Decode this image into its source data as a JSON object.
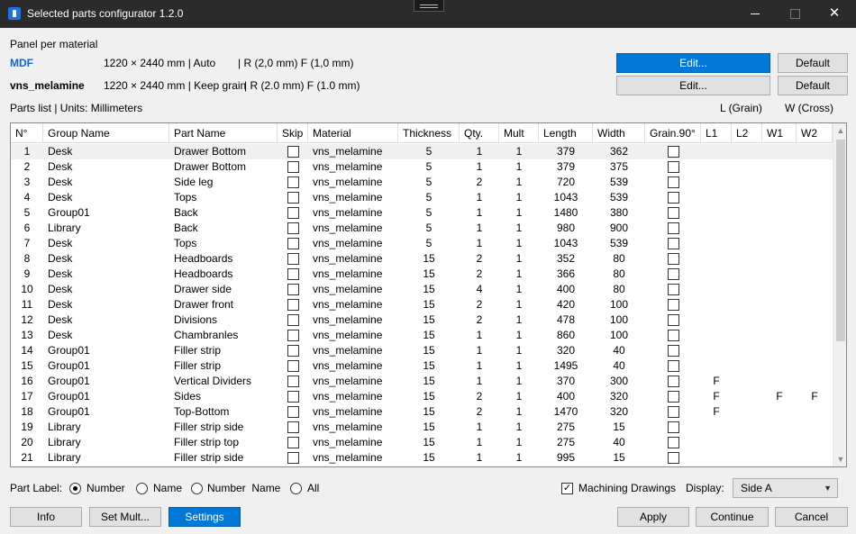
{
  "window": {
    "title": "Selected parts configurator 1.2.0",
    "close_glyph": "✕"
  },
  "panel": {
    "heading": "Panel per material",
    "materials": [
      {
        "name": "MDF",
        "size": "1220 × 2440 mm | Auto",
        "params": "| R (2,0 mm)  F (1,0 mm)",
        "edit_label": "Edit...",
        "default_label": "Default"
      },
      {
        "name": "vns_melamine",
        "size": "1220 × 2440 mm | Keep grain",
        "params": "| R (2.0 mm)  F (1.0 mm)",
        "edit_label": "Edit...",
        "default_label": "Default"
      }
    ]
  },
  "parts": {
    "caption": "Parts list | Units: Millimeters",
    "l_grain": "L (Grain)",
    "w_cross": "W (Cross)",
    "columns": [
      "N°",
      "Group Name",
      "Part Name",
      "Skip",
      "Material",
      "Thickness",
      "Qty.",
      "Mult",
      "Length",
      "Width",
      "Grain.90°",
      "L1",
      "L2",
      "W1",
      "W2"
    ],
    "rows": [
      [
        "1",
        "Desk",
        "Drawer Bottom",
        "",
        "vns_melamine",
        "5",
        "1",
        "1",
        "379",
        "362",
        "",
        "",
        "",
        "",
        ""
      ],
      [
        "2",
        "Desk",
        "Drawer Bottom",
        "",
        "vns_melamine",
        "5",
        "1",
        "1",
        "379",
        "375",
        "",
        "",
        "",
        "",
        ""
      ],
      [
        "3",
        "Desk",
        "Side leg",
        "",
        "vns_melamine",
        "5",
        "2",
        "1",
        "720",
        "539",
        "",
        "",
        "",
        "",
        ""
      ],
      [
        "4",
        "Desk",
        "Tops",
        "",
        "vns_melamine",
        "5",
        "1",
        "1",
        "1043",
        "539",
        "",
        "",
        "",
        "",
        ""
      ],
      [
        "5",
        "Group01",
        "Back",
        "",
        "vns_melamine",
        "5",
        "1",
        "1",
        "1480",
        "380",
        "",
        "",
        "",
        "",
        ""
      ],
      [
        "6",
        "Library",
        "Back",
        "",
        "vns_melamine",
        "5",
        "1",
        "1",
        "980",
        "900",
        "",
        "",
        "",
        "",
        ""
      ],
      [
        "7",
        "Desk",
        "Tops",
        "",
        "vns_melamine",
        "5",
        "1",
        "1",
        "1043",
        "539",
        "",
        "",
        "",
        "",
        ""
      ],
      [
        "8",
        "Desk",
        "Headboards",
        "",
        "vns_melamine",
        "15",
        "2",
        "1",
        "352",
        "80",
        "",
        "",
        "",
        "",
        ""
      ],
      [
        "9",
        "Desk",
        "Headboards",
        "",
        "vns_melamine",
        "15",
        "2",
        "1",
        "366",
        "80",
        "",
        "",
        "",
        "",
        ""
      ],
      [
        "10",
        "Desk",
        "Drawer side",
        "",
        "vns_melamine",
        "15",
        "4",
        "1",
        "400",
        "80",
        "",
        "",
        "",
        "",
        ""
      ],
      [
        "11",
        "Desk",
        "Drawer front",
        "",
        "vns_melamine",
        "15",
        "2",
        "1",
        "420",
        "100",
        "",
        "",
        "",
        "",
        ""
      ],
      [
        "12",
        "Desk",
        "Divisions",
        "",
        "vns_melamine",
        "15",
        "2",
        "1",
        "478",
        "100",
        "",
        "",
        "",
        "",
        ""
      ],
      [
        "13",
        "Desk",
        "Chambranles",
        "",
        "vns_melamine",
        "15",
        "1",
        "1",
        "860",
        "100",
        "",
        "",
        "",
        "",
        ""
      ],
      [
        "14",
        "Group01",
        "Filler strip",
        "",
        "vns_melamine",
        "15",
        "1",
        "1",
        "320",
        "40",
        "",
        "",
        "",
        "",
        ""
      ],
      [
        "15",
        "Group01",
        "Filler strip",
        "",
        "vns_melamine",
        "15",
        "1",
        "1",
        "1495",
        "40",
        "",
        "",
        "",
        "",
        ""
      ],
      [
        "16",
        "Group01",
        "Vertical Dividers",
        "",
        "vns_melamine",
        "15",
        "1",
        "1",
        "370",
        "300",
        "",
        "F",
        "",
        "",
        ""
      ],
      [
        "17",
        "Group01",
        "Sides",
        "",
        "vns_melamine",
        "15",
        "2",
        "1",
        "400",
        "320",
        "",
        "F",
        "",
        "F",
        "F"
      ],
      [
        "18",
        "Group01",
        "Top-Bottom",
        "",
        "vns_melamine",
        "15",
        "2",
        "1",
        "1470",
        "320",
        "",
        "F",
        "",
        "",
        ""
      ],
      [
        "19",
        "Library",
        "Filler strip side",
        "",
        "vns_melamine",
        "15",
        "1",
        "1",
        "275",
        "15",
        "",
        "",
        "",
        "",
        ""
      ],
      [
        "20",
        "Library",
        "Filler strip top",
        "",
        "vns_melamine",
        "15",
        "1",
        "1",
        "275",
        "40",
        "",
        "",
        "",
        "",
        ""
      ],
      [
        "21",
        "Library",
        "Filler strip side",
        "",
        "vns_melamine",
        "15",
        "1",
        "1",
        "995",
        "15",
        "",
        "",
        "",
        "",
        ""
      ]
    ]
  },
  "footer": {
    "part_label": "Part Label:",
    "radio_options": [
      "Number",
      "Name",
      "Number  Name",
      "All"
    ],
    "radio_selected": "Number",
    "machining_label": "Machining Drawings",
    "machining_checked": true,
    "display_label": "Display:",
    "display_value": "Side A",
    "buttons": {
      "info": "Info",
      "set_mult": "Set Mult...",
      "settings": "Settings",
      "apply": "Apply",
      "continue": "Continue",
      "cancel": "Cancel"
    }
  }
}
